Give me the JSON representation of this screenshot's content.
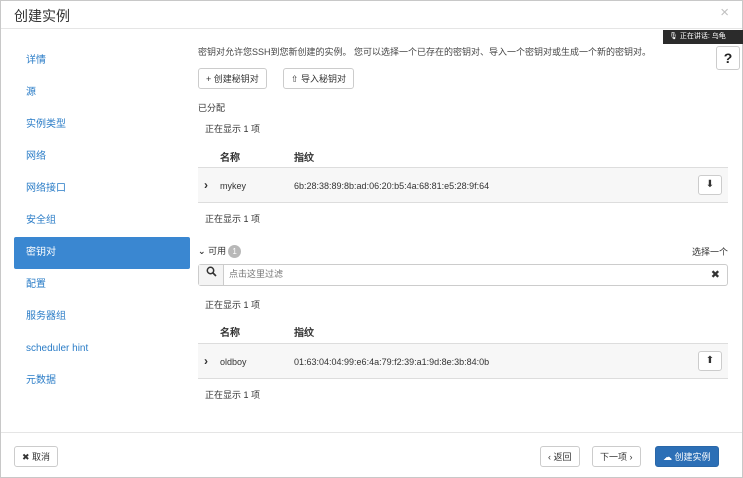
{
  "modal": {
    "title": "创建实例",
    "close_icon": "×"
  },
  "sidebar": {
    "items": [
      {
        "label": "详情"
      },
      {
        "label": "源"
      },
      {
        "label": "实例类型"
      },
      {
        "label": "网络"
      },
      {
        "label": "网络接口"
      },
      {
        "label": "安全组"
      },
      {
        "label": "密钥对"
      },
      {
        "label": "配置"
      },
      {
        "label": "服务器组"
      },
      {
        "label": "scheduler hint"
      },
      {
        "label": "元数据"
      }
    ],
    "active_index": 6
  },
  "main": {
    "intro": "密钥对允许您SSH到您新创建的实例。 您可以选择一个已存在的密钥对、导入一个密钥对或生成一个新的密钥对。",
    "create_keypair_label": "+ 创建秘钥对",
    "import_keypair_label": "⇧ 导入秘钥对",
    "allocated_title": "已分配",
    "allocated_showing_top": "正在显示 1 项",
    "allocated_columns": {
      "name": "名称",
      "fingerprint": "指纹"
    },
    "allocated_rows": [
      {
        "name": "mykey",
        "fingerprint": "6b:28:38:89:8b:ad:06:20:b5:4a:68:81:e5:28:9f:64"
      }
    ],
    "allocated_showing_bottom": "正在显示 1 项",
    "available_label": "可用",
    "available_count": "1",
    "select_one": "选择一个",
    "filter_placeholder": "点击这里过滤",
    "available_showing_top": "正在显示 1 项",
    "available_columns": {
      "name": "名称",
      "fingerprint": "指纹"
    },
    "available_rows": [
      {
        "name": "oldboy",
        "fingerprint": "01:63:04:04:99:e6:4a:79:f2:39:a1:9d:8e:3b:84:0b"
      }
    ],
    "available_showing_bottom": "正在显示 1 项"
  },
  "footer": {
    "cancel_label": "✖ 取消",
    "back_label": "‹ 返回",
    "next_label": "下一项 ›",
    "launch_label": "创建实例"
  },
  "overlay": {
    "speech_text": "正在讲话: 乌龟",
    "help_icon": "?"
  },
  "colors": {
    "accent": "#3a87d1",
    "primary_button": "#2c6fb6",
    "link": "#2a7cc7"
  }
}
